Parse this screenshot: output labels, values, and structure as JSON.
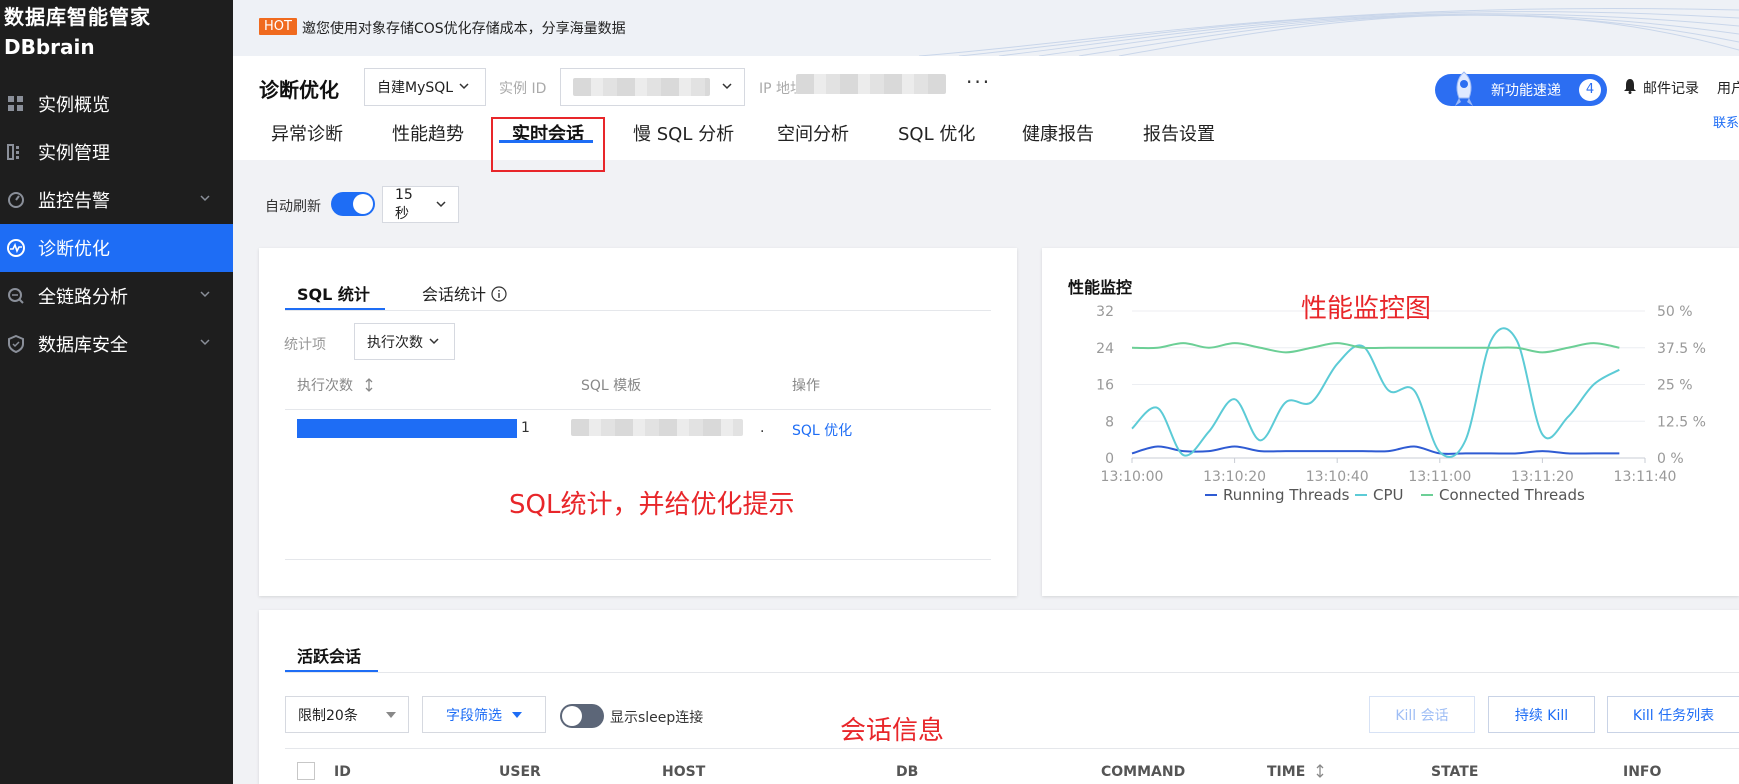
{
  "brand": {
    "title": "数据库智能管家",
    "subtitle": "DBbrain"
  },
  "sidebar": {
    "items": [
      {
        "label": "实例概览",
        "icon": "grid-icon"
      },
      {
        "label": "实例管理",
        "icon": "list-icon"
      },
      {
        "label": "监控告警",
        "icon": "gauge-icon",
        "expandable": true
      },
      {
        "label": "诊断优化",
        "icon": "pulse-icon",
        "active": true
      },
      {
        "label": "全链路分析",
        "icon": "search-icon",
        "expandable": true
      },
      {
        "label": "数据库安全",
        "icon": "shield-icon",
        "expandable": true
      }
    ]
  },
  "banner": {
    "tag": "HOT",
    "text": "邀您使用对象存储COS优化存储成本，分享海量数据"
  },
  "header": {
    "title": "诊断优化",
    "db_type": "自建MySQL",
    "instance_label": "实例 ID",
    "ip_label": "IP 地址",
    "more": "···",
    "new_feature": "新功能速递",
    "new_feature_count": "4",
    "mail": "邮件记录",
    "user": "用户",
    "contact": "联系"
  },
  "tabs": [
    "异常诊断",
    "性能趋势",
    "实时会话",
    "慢 SQL 分析",
    "空间分析",
    "SQL 优化",
    "健康报告",
    "报告设置"
  ],
  "active_tab": "实时会话",
  "refresh": {
    "label": "自动刷新",
    "enabled": true,
    "interval": "15 秒"
  },
  "sql_card": {
    "tabs": [
      "SQL 统计",
      "会话统计"
    ],
    "stat_label": "统计项",
    "stat_value": "执行次数",
    "columns": [
      "执行次数",
      "SQL 模板",
      "操作"
    ],
    "rows": [
      {
        "count": "1",
        "template_suffix": ".",
        "action": "SQL 优化"
      }
    ]
  },
  "perf_card": {
    "title": "性能监控"
  },
  "annotations": {
    "sql": "SQL统计，并给优化提示",
    "perf": "性能监控图",
    "session": "会话信息"
  },
  "session_card": {
    "tab": "活跃会话",
    "limit": "限制20条",
    "field_filter": "字段筛选",
    "sleep_label": "显示sleep连接",
    "sleep_enabled": false,
    "buttons": [
      "Kill 会话",
      "持续 Kill",
      "Kill 任务列表"
    ],
    "columns": [
      "ID",
      "USER",
      "HOST",
      "DB",
      "COMMAND",
      "TIME",
      "STATE",
      "INFO"
    ]
  },
  "chart_data": {
    "type": "line",
    "title": "性能监控",
    "x": [
      "13:10:00",
      "13:10:05",
      "13:10:10",
      "13:10:15",
      "13:10:20",
      "13:10:25",
      "13:10:30",
      "13:10:35",
      "13:10:40",
      "13:10:45",
      "13:10:50",
      "13:10:55",
      "13:11:00",
      "13:11:05",
      "13:11:10",
      "13:11:15",
      "13:11:20",
      "13:11:25",
      "13:11:30",
      "13:11:35"
    ],
    "x_ticks": [
      "13:10:00",
      "13:10:20",
      "13:10:40",
      "13:11:00",
      "13:11:20",
      "13:11:40"
    ],
    "ylim_left": [
      0,
      32
    ],
    "y_ticks_left": [
      "0",
      "8",
      "16",
      "24",
      "32"
    ],
    "ylim_right": [
      0,
      50
    ],
    "y_ticks_right": [
      "0 %",
      "12.5 %",
      "25 %",
      "37.5 %",
      "50 %"
    ],
    "series": [
      {
        "name": "Running Threads",
        "color": "#2f5bd3",
        "axis": "left",
        "values": [
          1,
          2.5,
          1.5,
          1.5,
          2.5,
          1.5,
          1.5,
          1.5,
          1.5,
          1.5,
          1.5,
          2.5,
          1,
          1,
          1,
          1,
          1.5,
          1,
          1,
          1
        ]
      },
      {
        "name": "CPU",
        "color": "#5ccbd6",
        "axis": "right",
        "values": [
          10,
          17,
          1,
          9,
          20,
          6,
          19,
          19,
          32,
          38,
          23,
          23,
          2,
          6,
          40,
          40,
          8,
          14,
          25,
          30
        ]
      },
      {
        "name": "Connected Threads",
        "color": "#6ccf96",
        "axis": "left",
        "values": [
          24,
          24,
          25,
          24,
          25,
          24,
          23,
          24,
          25,
          24,
          24,
          24,
          24,
          24,
          24,
          24,
          23,
          24,
          25,
          24
        ]
      }
    ],
    "grid": true,
    "legend_position": "bottom"
  }
}
